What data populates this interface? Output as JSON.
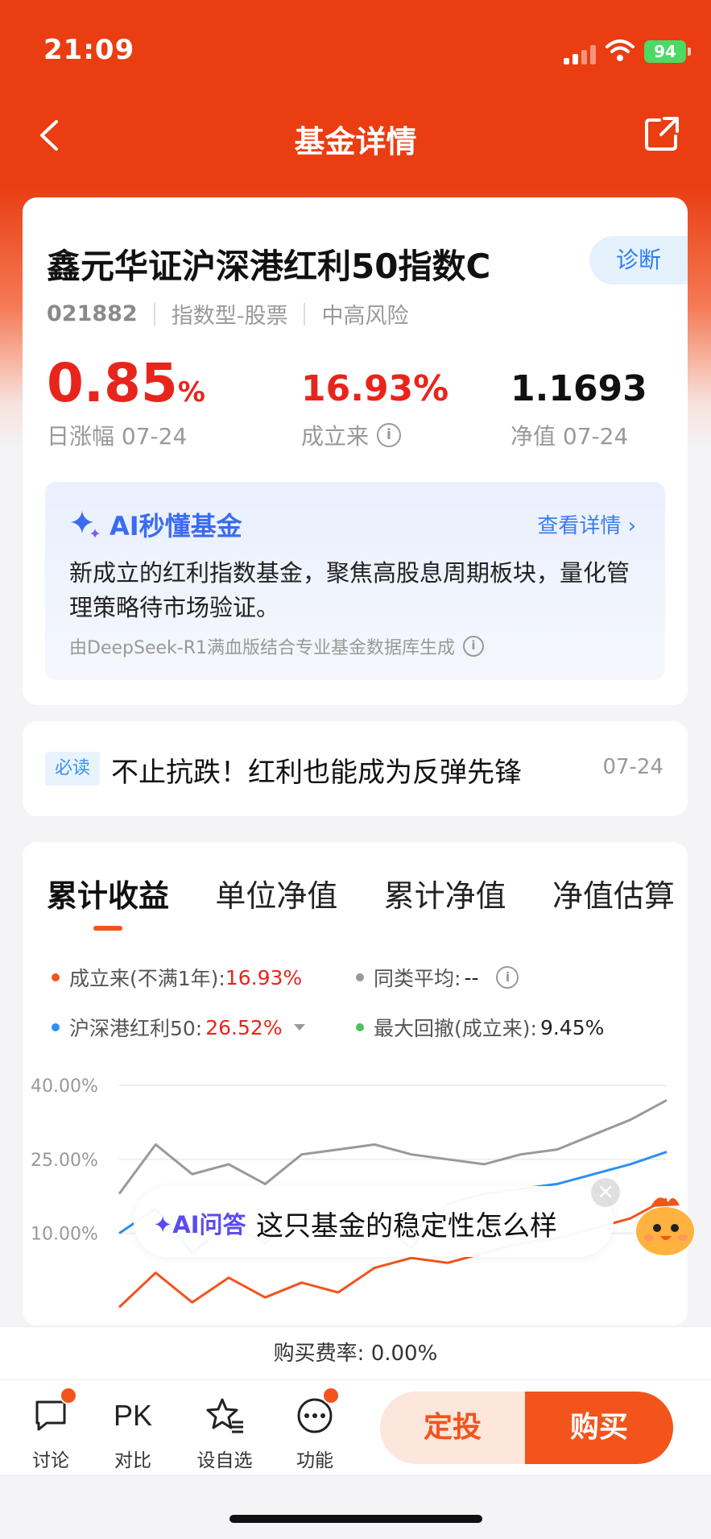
{
  "status_bar": {
    "time": "21:09",
    "battery": "94"
  },
  "nav": {
    "title": "基金详情"
  },
  "fund": {
    "name": "鑫元华证沪深港红利50指数C",
    "diagnose_label": "诊断",
    "code": "021882",
    "type": "指数型-股票",
    "risk": "中高风险",
    "daily_change_value": "0.85",
    "daily_change_unit": "%",
    "daily_change_label": "日涨幅 07-24",
    "since_inception_value": "16.93%",
    "since_inception_label": "成立来",
    "nav_value": "1.1693",
    "nav_label": "净值 07-24"
  },
  "ai_summary": {
    "title": "AI秒懂基金",
    "detail_link": "查看详情",
    "text": "新成立的红利指数基金，聚焦高股息周期板块，量化管理策略待市场验证。",
    "note": "由DeepSeek-R1满血版结合专业基金数据库生成"
  },
  "news": {
    "tag": "必读",
    "title": "不止抗跌！红利也能成为反弹先锋",
    "date": "07-24"
  },
  "chart_tabs": [
    "累计收益",
    "单位净值",
    "累计净值",
    "净值估算"
  ],
  "legend": {
    "since_label": "成立来(不满1年):",
    "since_value": "16.93%",
    "peer_label": "同类平均:",
    "peer_value": "--",
    "index_label": "沪深港红利50:",
    "index_value": "26.52%",
    "drawdown_label": "最大回撤(成立来):",
    "drawdown_value": "9.45%"
  },
  "colors": {
    "brand": "#ea3d12",
    "fund_line": "#f2541c",
    "index_line": "#2e8ff0",
    "peer_line": "#999999",
    "drawdown": "#4cc25a"
  },
  "chart_data": {
    "type": "line",
    "yticks": [
      "40.00%",
      "25.00%",
      "10.00%"
    ],
    "ylim": [
      0,
      40
    ],
    "series": [
      {
        "name": "成立来(不满1年)",
        "values": [
          -5,
          2,
          -4,
          1,
          -3,
          0,
          -2,
          3,
          5,
          4,
          6,
          8,
          9,
          11,
          13,
          17
        ]
      },
      {
        "name": "同类平均",
        "values": [
          18,
          28,
          22,
          24,
          20,
          26,
          27,
          28,
          26,
          25,
          24,
          26,
          27,
          30,
          33,
          37
        ]
      },
      {
        "name": "沪深港红利50",
        "values": [
          10,
          15,
          6,
          12,
          8,
          14,
          10,
          13,
          7,
          16,
          18,
          19,
          20,
          22,
          24,
          26.5
        ]
      }
    ]
  },
  "ai_ask": {
    "label": "AI问答",
    "question": "这只基金的稳定性怎么样"
  },
  "fee": {
    "label": "购买费率:",
    "value": "0.00%"
  },
  "toolbar": {
    "discuss": "讨论",
    "pk_glyph": "PK",
    "compare": "对比",
    "watchlist": "设自选",
    "functions": "功能",
    "invest": "定投",
    "buy": "购买"
  }
}
